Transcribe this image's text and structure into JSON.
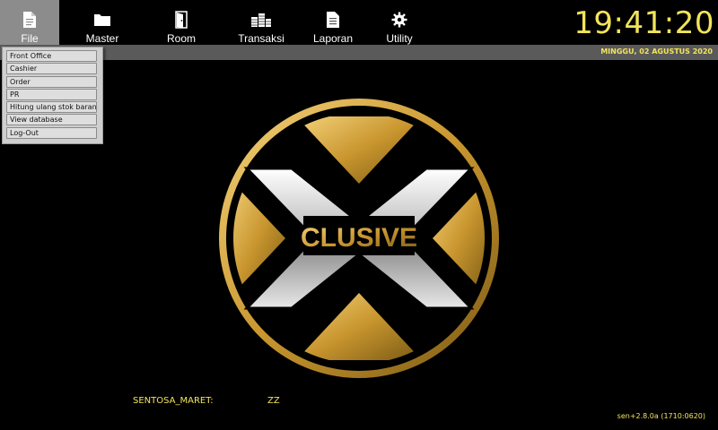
{
  "toolbar": {
    "items": [
      {
        "label": "File",
        "icon": "file-icon",
        "active": true
      },
      {
        "label": "Master",
        "icon": "folder-icon"
      },
      {
        "label": "Room",
        "icon": "door-icon"
      },
      {
        "label": "Transaksi",
        "icon": "coins-icon"
      },
      {
        "label": "Laporan",
        "icon": "report-icon"
      },
      {
        "label": "Utility",
        "icon": "gear-icon"
      }
    ],
    "active_bg": "#8c8c8c"
  },
  "clock": "19:41:20",
  "date": "MINGGU, 02 AGUSTUS 2020",
  "file_menu": {
    "items": [
      "Front Office",
      "Cashier",
      "Order",
      "PR",
      "Hitung ulang stok barang",
      "View database",
      "Log-Out"
    ]
  },
  "logo": {
    "text": "CLUSIVE",
    "gold": "#d4a93a",
    "silver": "#c7c7c7"
  },
  "footer": {
    "user": "SENTOSA_MARET:",
    "code": "ZZ",
    "version": "sen+2.8.0a (1710:0620)"
  },
  "colors": {
    "accent_yellow": "#f3e45a",
    "background": "#000000",
    "subbar": "#5a5a5a"
  }
}
